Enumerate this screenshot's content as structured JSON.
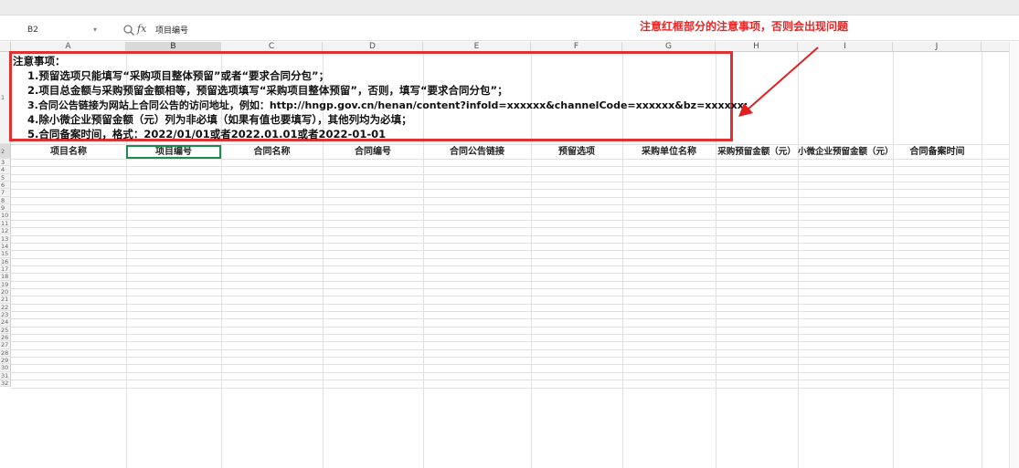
{
  "namebox": {
    "cell_ref": "B2",
    "dropdown_glyph": "▾"
  },
  "formula": {
    "fx_label": "fx",
    "content": "项目编号"
  },
  "annotation": {
    "text": "注意红框部分的注意事项，否则会出现问题",
    "color": "#ee2222"
  },
  "columns": [
    "A",
    "B",
    "C",
    "D",
    "E",
    "F",
    "G",
    "H",
    "I",
    "J"
  ],
  "selected_column": "B",
  "rows": [
    "1",
    "2",
    "3",
    "4",
    "5",
    "6",
    "7",
    "8",
    "9",
    "10",
    "11",
    "12",
    "13",
    "14",
    "15",
    "16",
    "17",
    "18",
    "19",
    "20",
    "21",
    "22",
    "23",
    "24",
    "25",
    "26",
    "27",
    "28",
    "29",
    "30",
    "31",
    "32"
  ],
  "notice": {
    "title": "注意事项：",
    "lines": [
      "1.预留选项只能填写“采购项目整体预留”或者“要求合同分包”；",
      "2.项目总金额与采购预留金额相等，预留选项填写“采购项目整体预留”，否则，填写“要求合同分包”；",
      "3.合同公告链接为网站上合同公告的访问地址，例如：http://hngp.gov.cn/henan/content?infold=xxxxxx&channelCode=xxxxxx&bz=xxxxxx;",
      "4.除小微企业预留金额（元）列为非必填（如果有值也要填写），其他列均为必填；",
      "5.合同备案时间，格式：2022/01/01或者2022.01.01或者2022-01-01"
    ],
    "border_color": "#e03030"
  },
  "header_row": [
    "项目名称",
    "项目编号",
    "合同名称",
    "合同编号",
    "合同公告链接",
    "预留选项",
    "采购单位名称",
    "采购预留金额（元）",
    "小微企业预留金额（元）",
    "合同备案时间"
  ],
  "selection_color": "#1e8a4e"
}
